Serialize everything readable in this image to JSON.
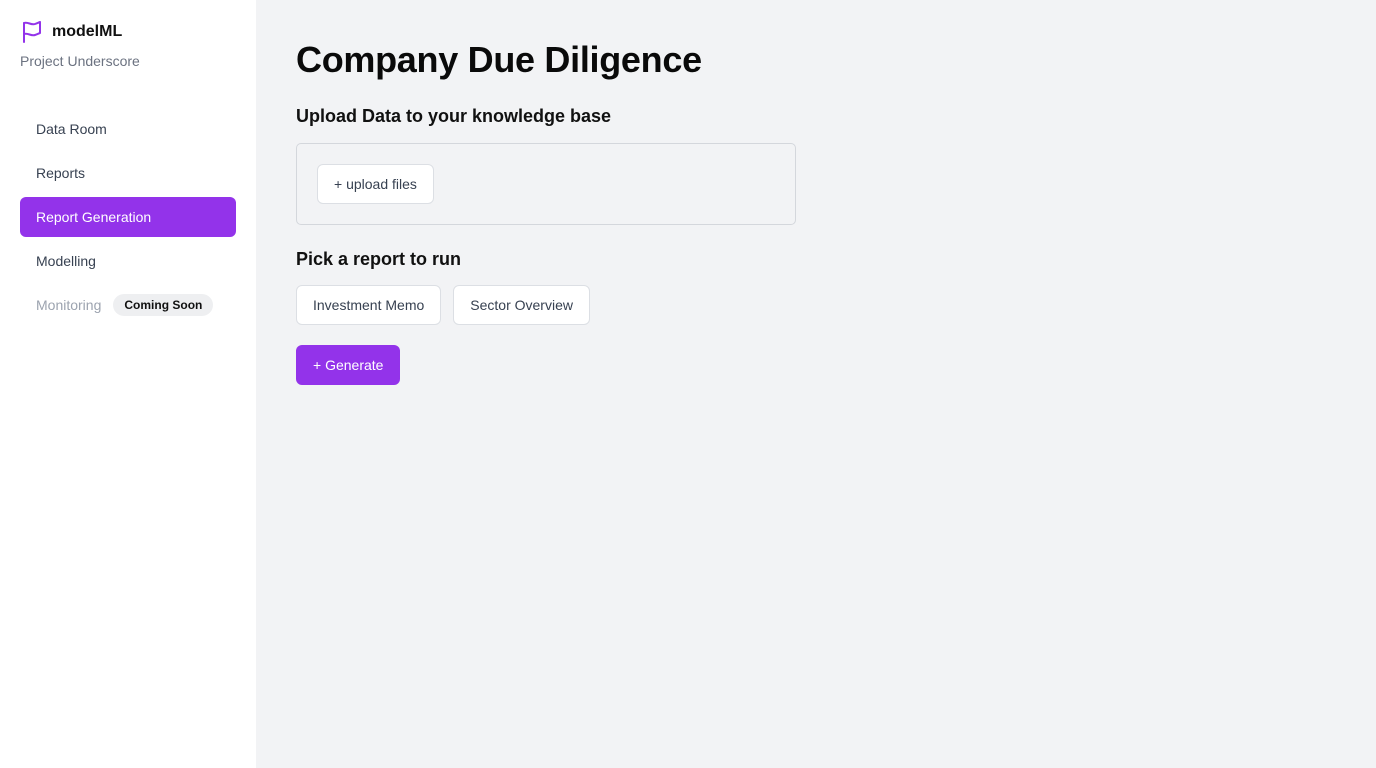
{
  "brand": {
    "name": "modelML",
    "project": "Project Underscore",
    "icon": "flag-icon",
    "accent_color": "#9333ea"
  },
  "sidebar": {
    "items": [
      {
        "label": "Data Room"
      },
      {
        "label": "Reports"
      },
      {
        "label": "Report Generation",
        "active": true
      },
      {
        "label": "Modelling"
      },
      {
        "label": "Monitoring",
        "badge": "Coming Soon",
        "disabled": true
      }
    ]
  },
  "main": {
    "title": "Company Due Diligence",
    "upload_heading": "Upload Data to your knowledge base",
    "upload_button": "+ upload files",
    "pick_heading": "Pick a report to run",
    "report_options": [
      "Investment Memo",
      "Sector Overview"
    ],
    "generate_button": "+ Generate"
  }
}
